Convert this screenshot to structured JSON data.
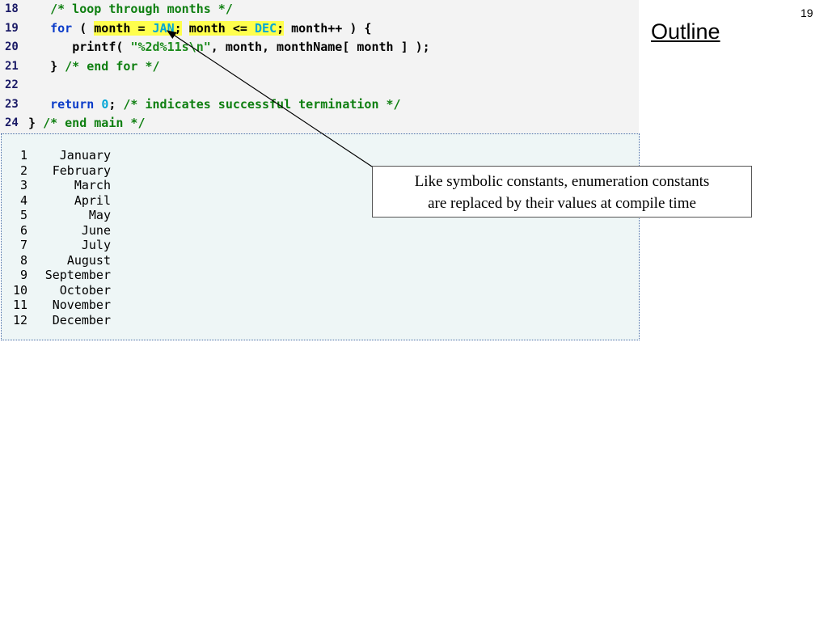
{
  "slide": {
    "number": "19",
    "outline_label": "Outline"
  },
  "code_lines": [
    {
      "num": "18",
      "indent": "   ",
      "parts": [
        {
          "t": "/* loop through months */",
          "c": "cm"
        }
      ]
    },
    {
      "num": "19",
      "indent": "   ",
      "parts": [
        {
          "t": "for",
          "c": "kw"
        },
        {
          "t": " ( ",
          "c": ""
        },
        {
          "t": "month = ",
          "c": "hl"
        },
        {
          "t": "JAN",
          "c": "hl num"
        },
        {
          "t": ";",
          "c": "hl"
        },
        {
          "t": " ",
          "c": ""
        },
        {
          "t": "month <= ",
          "c": "hl"
        },
        {
          "t": "DEC",
          "c": "hl num"
        },
        {
          "t": ";",
          "c": "hl"
        },
        {
          "t": " month++ ) {",
          "c": ""
        }
      ]
    },
    {
      "num": "20",
      "indent": "      ",
      "parts": [
        {
          "t": "printf( ",
          "c": ""
        },
        {
          "t": "\"%2d%11s\\n\"",
          "c": "str"
        },
        {
          "t": ", month, monthName[ month ] );",
          "c": ""
        }
      ]
    },
    {
      "num": "21",
      "indent": "   ",
      "parts": [
        {
          "t": "} ",
          "c": ""
        },
        {
          "t": "/* end for */",
          "c": "cm"
        }
      ]
    },
    {
      "num": "22",
      "indent": "",
      "parts": []
    },
    {
      "num": "23",
      "indent": "   ",
      "parts": [
        {
          "t": "return",
          "c": "kw"
        },
        {
          "t": " ",
          "c": ""
        },
        {
          "t": "0",
          "c": "num"
        },
        {
          "t": "; ",
          "c": ""
        },
        {
          "t": "/* indicates successful termination */",
          "c": "cm"
        }
      ]
    },
    {
      "num": "24",
      "indent": "",
      "parts": [
        {
          "t": "} ",
          "c": ""
        },
        {
          "t": "/* end main */",
          "c": "cm"
        }
      ]
    }
  ],
  "output_rows": [
    {
      "num": "1",
      "name": "January"
    },
    {
      "num": "2",
      "name": "February"
    },
    {
      "num": "3",
      "name": "March"
    },
    {
      "num": "4",
      "name": "April"
    },
    {
      "num": "5",
      "name": "May"
    },
    {
      "num": "6",
      "name": "June"
    },
    {
      "num": "7",
      "name": "July"
    },
    {
      "num": "8",
      "name": "August"
    },
    {
      "num": "9",
      "name": "September"
    },
    {
      "num": "10",
      "name": "October"
    },
    {
      "num": "11",
      "name": "November"
    },
    {
      "num": "12",
      "name": "December"
    }
  ],
  "callout": {
    "line1": "Like symbolic constants, enumeration constants",
    "line2": "are replaced by their values at compile time"
  },
  "colors": {
    "keyword": "#0b3cc9",
    "comment": "#0e7f10",
    "string": "#1b8a1b",
    "constant": "#00a6d6",
    "highlight": "#ffff4d",
    "output_bg": "#eef6f6"
  }
}
